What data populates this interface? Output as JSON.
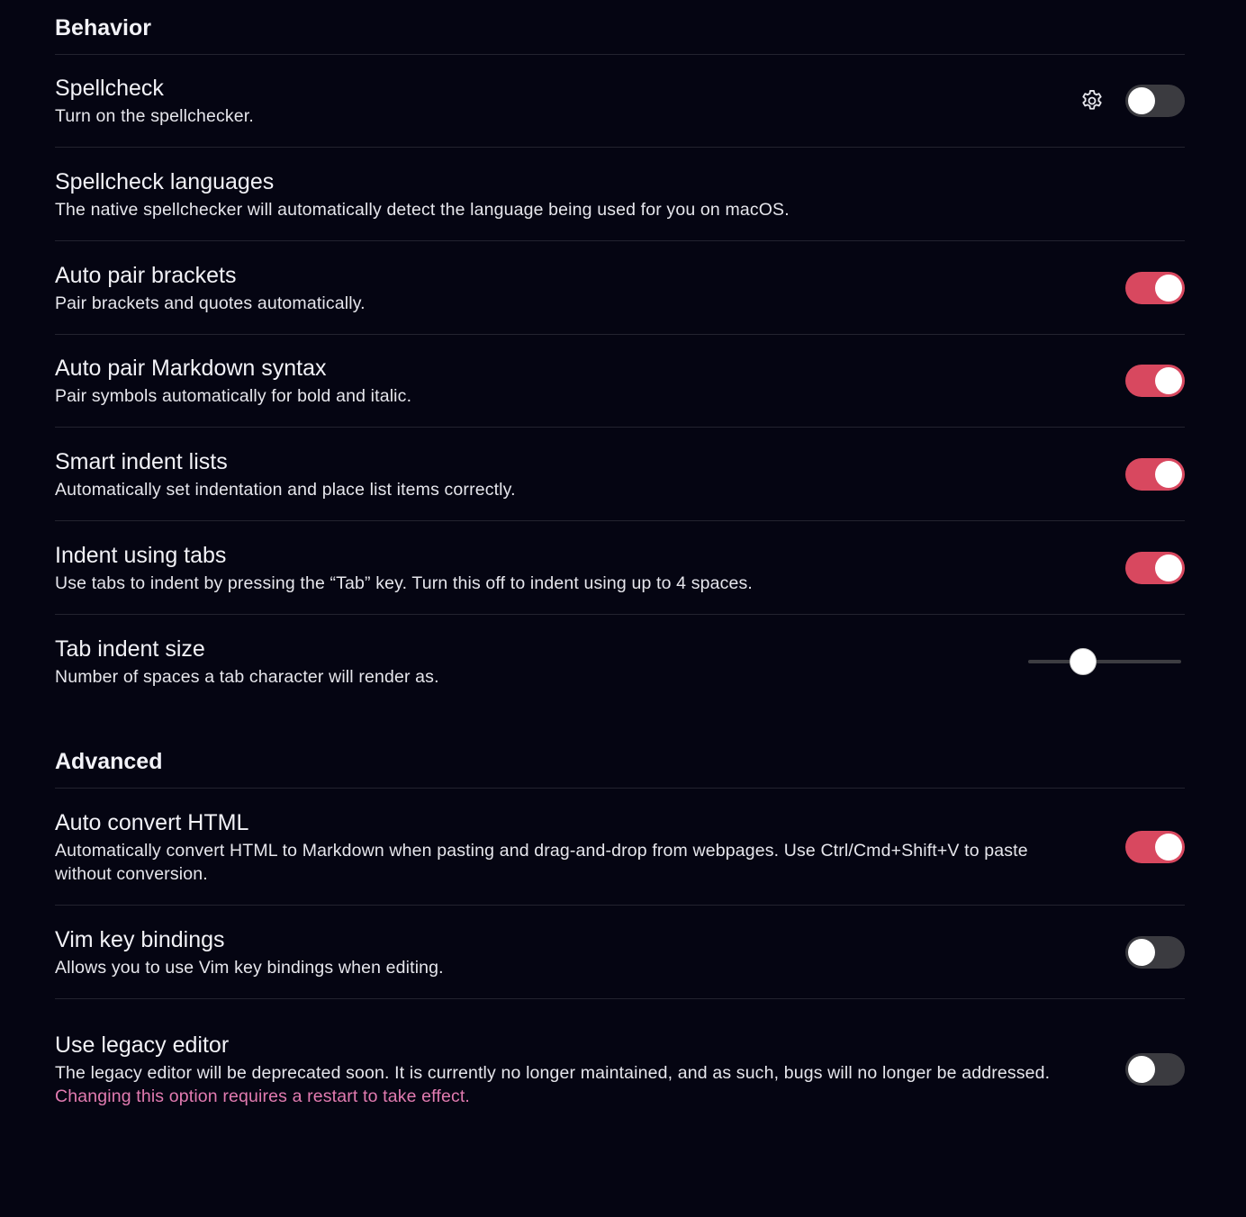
{
  "sections": {
    "behavior": {
      "title": "Behavior",
      "items": {
        "spellcheck": {
          "name": "Spellcheck",
          "desc": "Turn on the spellchecker.",
          "icon": "gear-icon",
          "toggle": "off"
        },
        "spellcheck_languages": {
          "name": "Spellcheck languages",
          "desc": "The native spellchecker will automatically detect the language being used for you on macOS."
        },
        "auto_pair_brackets": {
          "name": "Auto pair brackets",
          "desc": "Pair brackets and quotes automatically.",
          "toggle": "on"
        },
        "auto_pair_markdown": {
          "name": "Auto pair Markdown syntax",
          "desc": "Pair symbols automatically for bold and italic.",
          "toggle": "on"
        },
        "smart_indent_lists": {
          "name": "Smart indent lists",
          "desc": "Automatically set indentation and place list items correctly.",
          "toggle": "on"
        },
        "indent_using_tabs": {
          "name": "Indent using tabs",
          "desc": "Use tabs to indent by pressing the “Tab” key. Turn this off to indent using up to 4 spaces.",
          "toggle": "on"
        },
        "tab_indent_size": {
          "name": "Tab indent size",
          "desc": "Number of spaces a tab character will render as.",
          "slider_fraction": 0.33
        }
      }
    },
    "advanced": {
      "title": "Advanced",
      "items": {
        "auto_convert_html": {
          "name": "Auto convert HTML",
          "desc": "Automatically convert HTML to Markdown when pasting and drag-and-drop from webpages. Use Ctrl/Cmd+Shift+V to paste without conversion.",
          "toggle": "on"
        },
        "vim_key_bindings": {
          "name": "Vim key bindings",
          "desc": "Allows you to use Vim key bindings when editing.",
          "toggle": "off"
        },
        "legacy_editor": {
          "name": "Use legacy editor",
          "desc": "The legacy editor will be deprecated soon. It is currently no longer maintained, and as such, bugs will no longer be addressed.",
          "warning": "Changing this option requires a restart to take effect.",
          "toggle": "off"
        }
      }
    }
  },
  "colors": {
    "background": "#050512",
    "toggle_on": "#d8485f",
    "toggle_off": "#3b3b40",
    "warning_text": "#e27bb1"
  }
}
